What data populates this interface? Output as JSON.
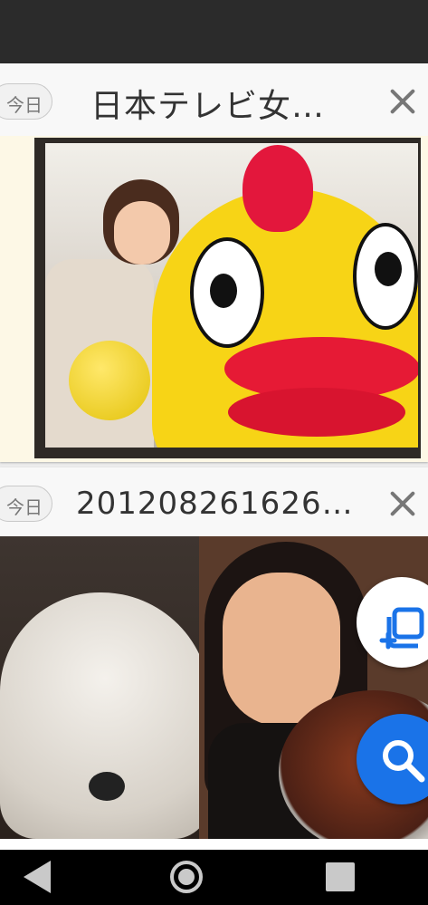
{
  "tabs": [
    {
      "badge": "今日",
      "title": "日本テレビ女…",
      "close_icon": "close-icon"
    },
    {
      "badge": "今日",
      "title": "201208261626…",
      "close_icon": "close-icon"
    }
  ],
  "fab": {
    "add_copy_icon": "add-to-collection-icon",
    "search_icon": "search-icon",
    "accent": "#1a73e8"
  },
  "navbar": {
    "back_icon": "back-icon",
    "home_icon": "home-icon",
    "recents_icon": "recents-icon"
  }
}
